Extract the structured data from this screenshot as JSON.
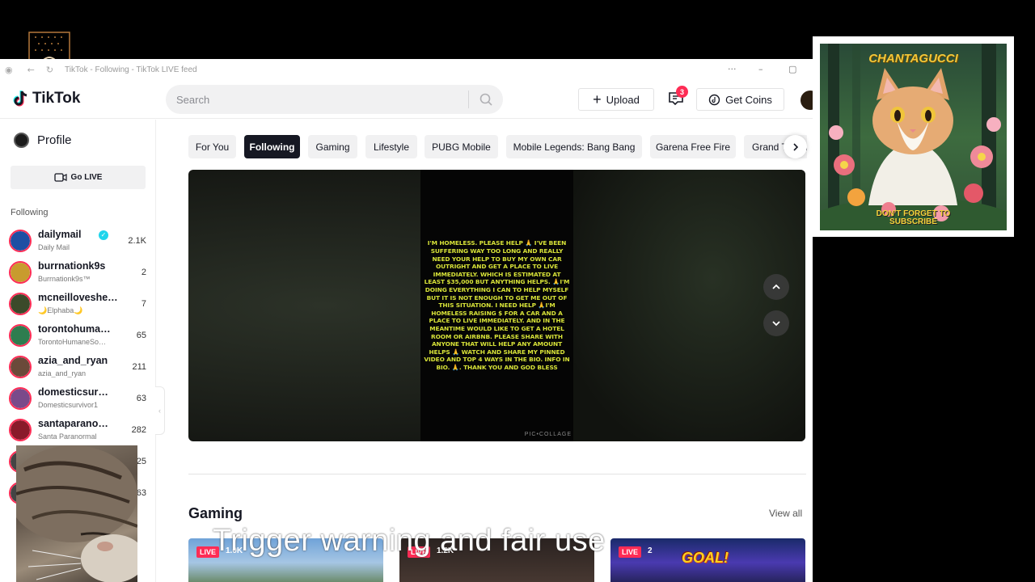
{
  "window": {
    "title": "TikTok - Following - TikTok LIVE feed"
  },
  "header": {
    "logo": "TikTok",
    "search_placeholder": "Search",
    "upload_label": "Upload",
    "inbox_badge": "3",
    "coins_label": "Get Coins"
  },
  "sidebar": {
    "profile_label": "Profile",
    "golive_label": "Go LIVE",
    "following_heading": "Following",
    "accounts": [
      {
        "name": "dailymail",
        "sub": "Daily Mail",
        "count": "2.1K",
        "verified": true,
        "color": "#1f4fa3"
      },
      {
        "name": "burrnationk9s",
        "sub": "Burrnationk9s™",
        "count": "2",
        "verified": false,
        "color": "#c89b2e"
      },
      {
        "name": "mcneilloveshe…",
        "sub": "🌙Elphaba🌙",
        "count": "7",
        "verified": false,
        "color": "#3b4a2a"
      },
      {
        "name": "torontohuma…",
        "sub": "TorontoHumaneSo…",
        "count": "65",
        "verified": false,
        "color": "#2e7d4f"
      },
      {
        "name": "azia_and_ryan",
        "sub": "azia_and_ryan",
        "count": "211",
        "verified": false,
        "color": "#6b4a3a"
      },
      {
        "name": "domesticsur…",
        "sub": "Domesticsurvivor1",
        "count": "63",
        "verified": false,
        "color": "#7a4a8a"
      },
      {
        "name": "santaparano…",
        "sub": "Santa Paranormal",
        "count": "282",
        "verified": false,
        "color": "#8a1a2a"
      },
      {
        "name": "",
        "sub": "",
        "count": "25",
        "verified": false,
        "color": "#444444"
      },
      {
        "name": "",
        "sub": "",
        "count": "63",
        "verified": false,
        "color": "#444444"
      }
    ]
  },
  "tabs": [
    {
      "label": "For You",
      "active": false
    },
    {
      "label": "Following",
      "active": true
    },
    {
      "label": "Gaming",
      "active": false
    },
    {
      "label": "Lifestyle",
      "active": false
    },
    {
      "label": "PUBG Mobile",
      "active": false
    },
    {
      "label": "Mobile Legends: Bang Bang",
      "active": false
    },
    {
      "label": "Garena Free Fire",
      "active": false
    },
    {
      "label": "Grand Theft Auto V",
      "active": false
    }
  ],
  "player": {
    "text": "I'm homeless. please help 🙏 I've been suffering way too long and really need your help to buy my own car outright and get a place to live immediately. which is estimated at least $35,000 but anything helps. 🙏I'm doing everything I can to help myself but it is not enough to get me out of this situation. I need help 🙏I'm homeless raising $ for a car and a place to live immediately. and in the meantime would like to get a hotel room or airbnb. please share with anyone that will help any amount helps 🙏 watch and share my pinned video and top 4 ways in the bio. info in bio. 🙏. thank you and god bless",
    "watermark": "PIC•COLLAGE"
  },
  "section": {
    "title": "Gaming",
    "view_all": "View all",
    "live_label": "LIVE",
    "thumbs": [
      {
        "viewers": "1.0K",
        "goal": ""
      },
      {
        "viewers": "1.2K",
        "goal": ""
      },
      {
        "viewers": "2",
        "goal": "GOAL!"
      }
    ]
  },
  "overlay": {
    "cat_title": "CHANTAGUCCI",
    "cat_sub_1": "DON'T FORGET TO",
    "cat_sub_2": "SUBSCRIBE",
    "caption": "Trigger warning and fair use"
  }
}
